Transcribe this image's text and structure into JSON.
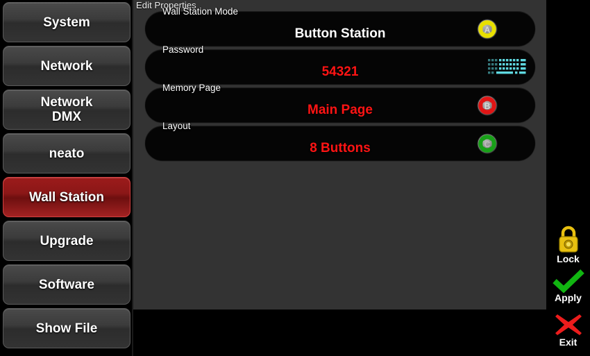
{
  "sidebar": {
    "items": [
      {
        "label": "System",
        "selected": false
      },
      {
        "label": "Network",
        "selected": false
      },
      {
        "label": "Network\nDMX",
        "selected": false
      },
      {
        "label": "neato",
        "selected": false
      },
      {
        "label": "Wall Station",
        "selected": true
      },
      {
        "label": "Upgrade",
        "selected": false
      },
      {
        "label": "Software",
        "selected": false
      },
      {
        "label": "Show File",
        "selected": false
      }
    ]
  },
  "panel": {
    "title": "Edit Properties",
    "rows": [
      {
        "label": "Wall Station Mode",
        "value": "Button Station",
        "value_color": "white",
        "icon": "xbox-a-button-icon"
      },
      {
        "label": "Password",
        "value": "54321",
        "value_color": "red",
        "icon": "keyboard-icon"
      },
      {
        "label": "Memory Page",
        "value": "Main Page",
        "value_color": "red",
        "icon": "xbox-b-button-icon"
      },
      {
        "label": "Layout",
        "value": "8 Buttons",
        "value_color": "red",
        "icon": "xbox-c-button-icon"
      }
    ]
  },
  "actions": [
    {
      "label": "Lock",
      "icon": "padlock-icon"
    },
    {
      "label": "Apply",
      "icon": "checkmark-icon"
    },
    {
      "label": "Exit",
      "icon": "cross-icon"
    }
  ],
  "colors": {
    "selected_red": "#8b1717",
    "value_red": "#ff1414",
    "panel_gray": "#333333",
    "row_black": "#050505",
    "lock_gold": "#e8c010",
    "apply_green": "#11b511",
    "exit_red": "#ec1c1c",
    "icon_a_accent": "#e8e000",
    "icon_b_accent": "#e01515",
    "icon_c_accent": "#18a018",
    "keyboard_cyan": "#5fd8e0"
  }
}
